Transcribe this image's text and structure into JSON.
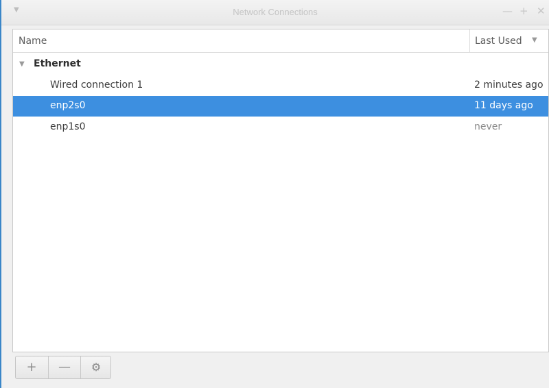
{
  "window": {
    "title": "Network Connections",
    "menu_icon": "chevron-down-icon",
    "minimize_icon": "minimize-icon",
    "maximize_icon": "maximize-icon",
    "close_icon": "close-icon",
    "minimize_glyph": "—",
    "maximize_glyph": "+",
    "close_glyph": "✕",
    "menu_glyph": "▼"
  },
  "table": {
    "columns": {
      "name": "Name",
      "last_used": "Last Used"
    },
    "sort_glyph": "▼",
    "group": {
      "label": "Ethernet",
      "expander_glyph": "▼"
    },
    "rows": [
      {
        "name": "Wired connection 1",
        "last_used": "2 minutes ago",
        "selected": false
      },
      {
        "name": "enp2s0",
        "last_used": "11 days ago",
        "selected": true
      },
      {
        "name": "enp1s0",
        "last_used": "never",
        "selected": false
      }
    ]
  },
  "toolbar": {
    "add_glyph": "+",
    "remove_glyph": "—",
    "settings_glyph": "⚙"
  },
  "colors": {
    "selection": "#3d8fe0",
    "accent_border": "#3a86c8"
  }
}
